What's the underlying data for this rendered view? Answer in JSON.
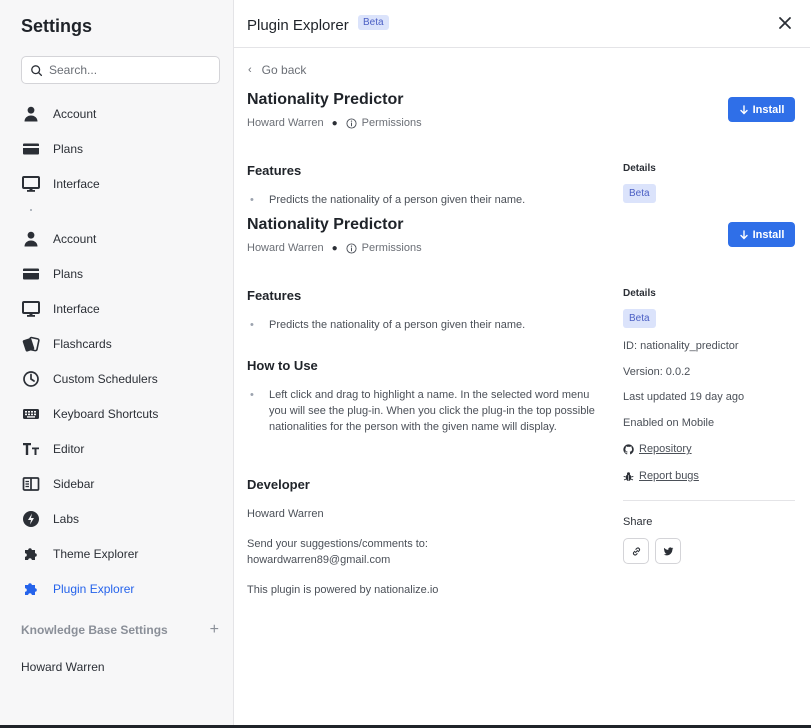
{
  "sidebar": {
    "title": "Settings",
    "search_placeholder": "Search...",
    "items": [
      {
        "label": "Account",
        "icon": "person-icon"
      },
      {
        "label": "Plans",
        "icon": "card-icon"
      },
      {
        "label": "Interface",
        "icon": "monitor-icon"
      },
      {
        "label": "Account",
        "icon": "person-icon"
      },
      {
        "label": "Plans",
        "icon": "card-icon"
      },
      {
        "label": "Interface",
        "icon": "monitor-icon"
      },
      {
        "label": "Flashcards",
        "icon": "flashcards-icon"
      },
      {
        "label": "Custom Schedulers",
        "icon": "clock-icon"
      },
      {
        "label": "Keyboard Shortcuts",
        "icon": "keyboard-icon"
      },
      {
        "label": "Editor",
        "icon": "text-size-icon"
      },
      {
        "label": "Sidebar",
        "icon": "sidebar-icon"
      },
      {
        "label": "Labs",
        "icon": "bolt-icon"
      },
      {
        "label": "Theme Explorer",
        "icon": "puzzle-icon"
      },
      {
        "label": "Plugin Explorer",
        "icon": "puzzle-icon",
        "active": true
      }
    ],
    "kb_section_label": "Knowledge Base Settings",
    "kb_add": "+",
    "kb_user": "Howard Warren"
  },
  "header": {
    "title": "Plugin Explorer",
    "badge": "Beta"
  },
  "main": {
    "back_label": "Go back",
    "plugin_name": "Nationality Predictor",
    "author": "Howard Warren",
    "permissions_label": "Permissions",
    "install_label": "Install",
    "features_heading": "Features",
    "feature_1": "Predicts the nationality of a person given their name.",
    "how_to_heading": "How to Use",
    "how_to_text": "Left click and drag to highlight a name. In the selected word menu you will see the plug-in. When you click the plug-in the top possible nationalities for the person with the given name will display.",
    "developer_heading": "Developer",
    "developer_name": "Howard Warren",
    "suggest_line": "Send your suggestions/comments to:",
    "email": "howardwarren89@gmail.com",
    "powered_by": "This plugin is powered by nationalize.io"
  },
  "details": {
    "heading": "Details",
    "badge": "Beta",
    "id": "ID: nationality_predictor",
    "version": "Version: 0.0.2",
    "updated": "Last updated 19 day ago",
    "mobile": "Enabled on Mobile",
    "repository": "Repository",
    "report_bugs": "Report bugs",
    "share_heading": "Share"
  },
  "colors": {
    "accent": "#2563eb",
    "install_bg": "#2f6fe8",
    "badge_bg": "#dbe3fb",
    "badge_text": "#4b5fc4"
  }
}
